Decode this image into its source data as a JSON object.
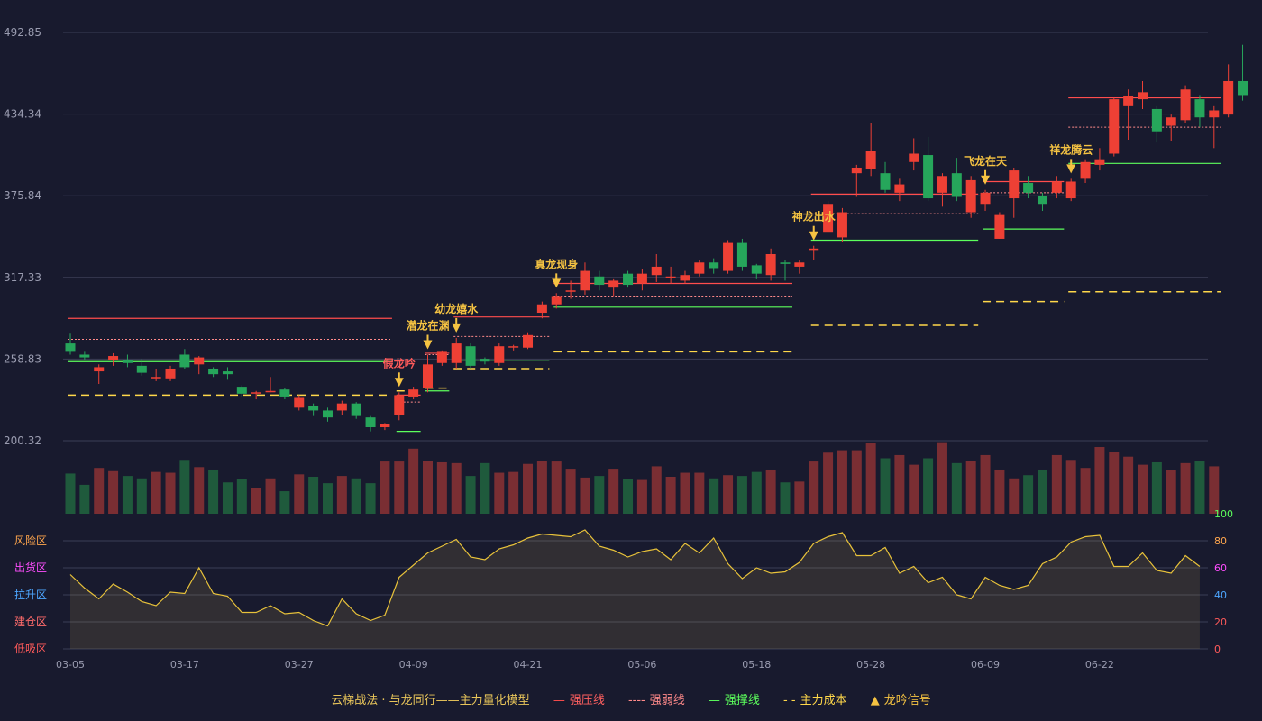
{
  "legend": {
    "title": "云梯战法 · 与龙同行——主力量化模型",
    "items": [
      {
        "label": "强压线",
        "symbol": "—",
        "color": "#ff4d4d"
      },
      {
        "label": "强弱线",
        "symbol": "----",
        "color": "#ff8a8a"
      },
      {
        "label": "强撑线",
        "symbol": "—",
        "color": "#5cff5c"
      },
      {
        "label": "主力成本",
        "symbol": "- -",
        "color": "#ffd84a"
      },
      {
        "label": "龙吟信号",
        "symbol": "▲",
        "color": "#f5c342"
      }
    ]
  },
  "chart_data": [
    {
      "type": "candlestick",
      "ylim": [
        173.31,
        492.85
      ],
      "yticks": [
        "492.85",
        "434.34",
        "375.84",
        "317.33",
        "258.83",
        "200.32"
      ],
      "xticks": [
        "03-05",
        "03-17",
        "03-27",
        "04-09",
        "04-21",
        "05-06",
        "05-18",
        "05-28",
        "06-09",
        "06-22"
      ],
      "xtick_index": [
        0,
        8,
        16,
        24,
        32,
        40,
        48,
        56,
        64,
        72
      ],
      "colors": {
        "up": "#ee4035",
        "down": "#26a65b",
        "resist": "#ff4d4d",
        "mid": "#ff8a8a",
        "support": "#5cff5c",
        "cost": "#ffd84a",
        "signal": "#f5c342"
      },
      "candles": [
        [
          270,
          264,
          277,
          262
        ],
        [
          262,
          260,
          264,
          258
        ],
        [
          250,
          253,
          255,
          241
        ],
        [
          258,
          261,
          263,
          254
        ],
        [
          258,
          256,
          262,
          253
        ],
        [
          254,
          249,
          259,
          247
        ],
        [
          246,
          246,
          252,
          243
        ],
        [
          245,
          252,
          254,
          243
        ],
        [
          262,
          253,
          266,
          252
        ],
        [
          255,
          260,
          261,
          248
        ],
        [
          252,
          248,
          253,
          246
        ],
        [
          250,
          248,
          253,
          244
        ],
        [
          239,
          234,
          240,
          232
        ],
        [
          235,
          235,
          236,
          230
        ],
        [
          236,
          236,
          246,
          235
        ],
        [
          237,
          232,
          238,
          230
        ],
        [
          224,
          231,
          233,
          222
        ],
        [
          225,
          222,
          227,
          218
        ],
        [
          222,
          217,
          224,
          214
        ],
        [
          222,
          227,
          229,
          219
        ],
        [
          227,
          218,
          228,
          216
        ],
        [
          217,
          210,
          218,
          207
        ],
        [
          210,
          212,
          213,
          208
        ],
        [
          219,
          233,
          235,
          215
        ],
        [
          232,
          237,
          239,
          230
        ],
        [
          238,
          255,
          262,
          235
        ],
        [
          256,
          264,
          265,
          254
        ],
        [
          256,
          270,
          274,
          252
        ],
        [
          268,
          254,
          270,
          252
        ],
        [
          259,
          257,
          260,
          255
        ],
        [
          256,
          268,
          270,
          254
        ],
        [
          268,
          268,
          269,
          265
        ],
        [
          267,
          276,
          278,
          266
        ],
        [
          292,
          298,
          300,
          288
        ],
        [
          298,
          304,
          306,
          295
        ],
        [
          307,
          308,
          315,
          302
        ],
        [
          308,
          322,
          328,
          305
        ],
        [
          318,
          312,
          322,
          308
        ],
        [
          310,
          315,
          316,
          304
        ],
        [
          320,
          312,
          322,
          310
        ],
        [
          313,
          320,
          323,
          308
        ],
        [
          319,
          325,
          334,
          314
        ],
        [
          318,
          318,
          325,
          313
        ],
        [
          315,
          319,
          322,
          313
        ],
        [
          320,
          328,
          330,
          318
        ],
        [
          328,
          324,
          331,
          320
        ],
        [
          322,
          342,
          344,
          320
        ],
        [
          342,
          325,
          345,
          322
        ],
        [
          326,
          320,
          327,
          316
        ],
        [
          319,
          334,
          338,
          315
        ],
        [
          328,
          327,
          330,
          315
        ],
        [
          325,
          328,
          330,
          320
        ],
        [
          337,
          338,
          340,
          330
        ],
        [
          350,
          370,
          372,
          350
        ],
        [
          346,
          364,
          367,
          343
        ],
        [
          392,
          396,
          398,
          375
        ],
        [
          395,
          408,
          428,
          390
        ],
        [
          392,
          380,
          400,
          378
        ],
        [
          378,
          384,
          388,
          372
        ],
        [
          400,
          406,
          417,
          394
        ],
        [
          405,
          374,
          418,
          372
        ],
        [
          378,
          390,
          392,
          368
        ],
        [
          392,
          375,
          403,
          372
        ],
        [
          364,
          387,
          390,
          360
        ],
        [
          370,
          378,
          380,
          365
        ],
        [
          345,
          362,
          364,
          345
        ],
        [
          374,
          394,
          396,
          360
        ],
        [
          385,
          378,
          390,
          374
        ],
        [
          376,
          370,
          378,
          365
        ],
        [
          378,
          386,
          390,
          374
        ],
        [
          374,
          386,
          388,
          372
        ],
        [
          388,
          400,
          402,
          385
        ],
        [
          398,
          402,
          410,
          394
        ],
        [
          406,
          445,
          446,
          404
        ],
        [
          440,
          447,
          452,
          416
        ],
        [
          445,
          450,
          458,
          438
        ],
        [
          438,
          422,
          440,
          414
        ],
        [
          426,
          432,
          434,
          415
        ],
        [
          430,
          452,
          455,
          428
        ],
        [
          445,
          432,
          448,
          425
        ],
        [
          432,
          437,
          440,
          410
        ],
        [
          434,
          458,
          470,
          432
        ],
        [
          458,
          448,
          484,
          444
        ]
      ],
      "volume": [
        50,
        36,
        57,
        53,
        47,
        44,
        52,
        51,
        67,
        58,
        55,
        39,
        43,
        32,
        44,
        28,
        49,
        46,
        38,
        47,
        44,
        38,
        65,
        65,
        81,
        66,
        64,
        63,
        47,
        63,
        51,
        52,
        62,
        66,
        65,
        56,
        45,
        47,
        56,
        43,
        42,
        59,
        46,
        51,
        51,
        44,
        48,
        47,
        52,
        55,
        39,
        40,
        65,
        76,
        79,
        79,
        88,
        69,
        73,
        61,
        69,
        89,
        63,
        66,
        73,
        55,
        44,
        48,
        55,
        73,
        67,
        57,
        83,
        77,
        71,
        61,
        64,
        54,
        63,
        66,
        59
      ],
      "volume_max": 92,
      "zones": [
        {
          "start": 0,
          "end": 22,
          "resist": 288,
          "mid": 273,
          "support": 257,
          "cost": 233
        },
        {
          "start": 23,
          "end": 24,
          "resist": 233,
          "mid": 228,
          "support": 207,
          "cost": 236
        },
        {
          "start": 25,
          "end": 26,
          "resist": 263,
          "mid": 262,
          "support": 236,
          "cost": 238
        },
        {
          "start": 27,
          "end": 33,
          "resist": 289,
          "mid": 275,
          "support": 258,
          "cost": 252
        },
        {
          "start": 34,
          "end": 50,
          "resist": 313,
          "mid": 304,
          "support": 296,
          "cost": 264
        },
        {
          "start": 52,
          "end": 63,
          "resist": 377,
          "mid": 363,
          "support": 344,
          "cost": 283
        },
        {
          "start": 64,
          "end": 69,
          "resist": 386,
          "mid": 378,
          "support": 352,
          "cost": 300
        },
        {
          "start": 70,
          "end": 80,
          "resist": 446,
          "mid": 425,
          "support": 399,
          "cost": 307
        }
      ],
      "signals": [
        {
          "index": 23,
          "label": "假龙吟",
          "color": "#ff5a5a"
        },
        {
          "index": 25,
          "label": "潜龙在渊",
          "color": "#f5c342"
        },
        {
          "index": 27,
          "label": "幼龙嬉水",
          "color": "#f5c342"
        },
        {
          "index": 34,
          "label": "真龙现身",
          "color": "#f5c342"
        },
        {
          "index": 52,
          "label": "神龙出水",
          "color": "#f5c342"
        },
        {
          "index": 64,
          "label": "飞龙在天",
          "color": "#f5c342"
        },
        {
          "index": 70,
          "label": "祥龙腾云",
          "color": "#f5c342"
        }
      ]
    },
    {
      "type": "area",
      "ylim": [
        0,
        100
      ],
      "yticks": [
        "100",
        "80",
        "60",
        "40",
        "20",
        "0"
      ],
      "zones": [
        {
          "label": "风险区",
          "color": "#ffa64d"
        },
        {
          "label": "出货区",
          "color": "#ff4dff"
        },
        {
          "label": "拉升区",
          "color": "#4da6ff"
        },
        {
          "label": "建仓区",
          "color": "#ff6b6b"
        },
        {
          "label": "低吸区",
          "color": "#ff5a5a"
        }
      ],
      "values": [
        55,
        45,
        37,
        48,
        42,
        35,
        32,
        42,
        41,
        60,
        41,
        39,
        27,
        27,
        32,
        26,
        27,
        21,
        17,
        37,
        26,
        21,
        25,
        53,
        62,
        71,
        76,
        81,
        68,
        66,
        74,
        77,
        82,
        85,
        84,
        83,
        88,
        76,
        73,
        68,
        72,
        74,
        66,
        78,
        71,
        82,
        63,
        52,
        60,
        56,
        57,
        64,
        78,
        83,
        86,
        69,
        69,
        75,
        56,
        61,
        49,
        53,
        40,
        37,
        53,
        47,
        44,
        47,
        63,
        68,
        79,
        83,
        84,
        61,
        61,
        71,
        58,
        56,
        69,
        61
      ]
    }
  ]
}
